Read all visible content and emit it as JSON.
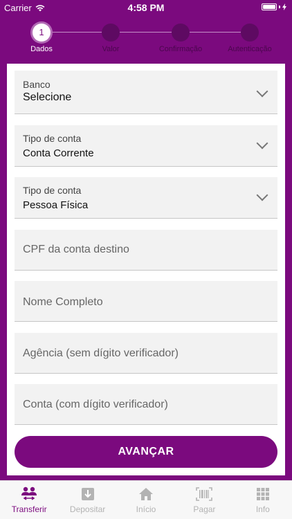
{
  "status_bar": {
    "carrier": "Carrier",
    "time": "4:58 PM"
  },
  "stepper": {
    "steps": [
      {
        "number": "1",
        "label": "Dados",
        "active": true
      },
      {
        "number": "",
        "label": "Valor",
        "active": false
      },
      {
        "number": "",
        "label": "Confirmação",
        "active": false
      },
      {
        "number": "",
        "label": "Autenticação",
        "active": false
      }
    ]
  },
  "form": {
    "banco": {
      "label": "Banco",
      "value": "Selecione"
    },
    "tipo_conta": {
      "label": "Tipo de conta",
      "value": "Conta Corrente"
    },
    "tipo_pessoa": {
      "label": "Tipo de conta",
      "value": "Pessoa Física"
    },
    "cpf": {
      "placeholder": "CPF da conta destino"
    },
    "nome": {
      "placeholder": "Nome Completo"
    },
    "agencia": {
      "placeholder": "Agência (sem dígito verificador)"
    },
    "conta": {
      "placeholder": "Conta (com dígito verificador)"
    },
    "submit_label": "AVANÇAR"
  },
  "tabbar": {
    "items": [
      {
        "label": "Transferir",
        "icon": "transfer-icon"
      },
      {
        "label": "Depositar",
        "icon": "deposit-icon"
      },
      {
        "label": "Início",
        "icon": "home-icon"
      },
      {
        "label": "Pagar",
        "icon": "barcode-icon"
      },
      {
        "label": "Info",
        "icon": "grid-icon"
      }
    ]
  },
  "colors": {
    "primary": "#7b0a7e",
    "inactive_tab": "#b3b3b3"
  }
}
